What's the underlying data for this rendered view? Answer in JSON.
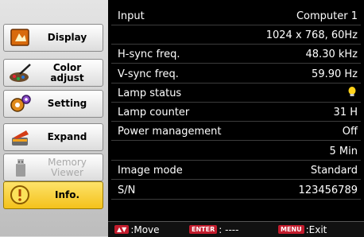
{
  "sidebar": {
    "items": [
      {
        "label": "Display",
        "icon": "display-icon"
      },
      {
        "label": "Color adjust",
        "icon": "color-adjust-icon"
      },
      {
        "label": "Setting",
        "icon": "setting-icon"
      },
      {
        "label": "Expand",
        "icon": "expand-icon"
      },
      {
        "label": "Memory Viewer",
        "icon": "memory-viewer-icon",
        "state": "disabled"
      },
      {
        "label": "Info.",
        "icon": "info-icon",
        "state": "selected"
      }
    ]
  },
  "info": {
    "rows": [
      {
        "label": "Input",
        "value": "Computer 1"
      },
      {
        "label": "",
        "value": "1024 x 768, 60Hz"
      },
      {
        "label": "H-sync freq.",
        "value": "48.30 kHz"
      },
      {
        "label": "V-sync freq.",
        "value": "59.90 Hz"
      },
      {
        "label": "Lamp status",
        "value": "",
        "icon": "lamp-status-icon"
      },
      {
        "label": "Lamp counter",
        "value": "31 H"
      },
      {
        "label": "Power management",
        "value": "Off"
      },
      {
        "label": "",
        "value": "5 Min"
      },
      {
        "label": "Image mode",
        "value": "Standard"
      },
      {
        "label": "S/N",
        "value": "123456789"
      }
    ]
  },
  "footer": {
    "move_key": "▲▼",
    "move_label": ":Move",
    "enter_key": "ENTER",
    "enter_label": ": ----",
    "menu_key": "MENU",
    "menu_label": ":Exit"
  },
  "colors": {
    "accent": "#f4c21b",
    "key_badge": "#c31c2d",
    "panel_bg": "#000000"
  }
}
